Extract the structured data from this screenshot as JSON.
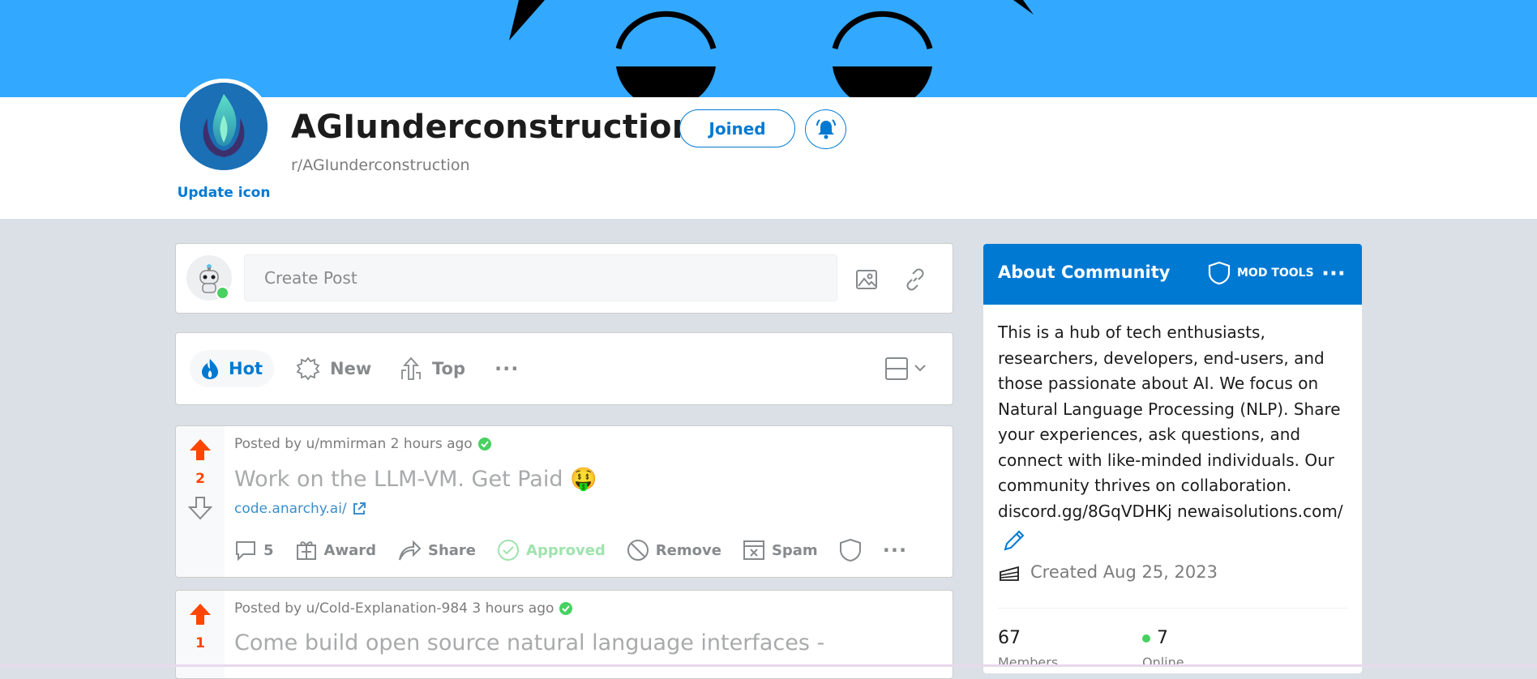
{
  "community": {
    "title": "AGIunderconstruction",
    "subreddit": "r/AGIunderconstruction",
    "update_icon_label": "Update icon",
    "joined_label": "Joined"
  },
  "create_post": {
    "placeholder": "Create Post"
  },
  "sort": {
    "hot": "Hot",
    "new": "New",
    "top": "Top"
  },
  "posts": [
    {
      "score": "2",
      "posted_by": "Posted by u/mmirman 2 hours ago",
      "title": "Work on the LLM-VM. Get Paid",
      "emoji": "🤑",
      "link": "code.anarchy.ai/",
      "comments": "5",
      "award": "Award",
      "share": "Share",
      "approved": "Approved",
      "remove": "Remove",
      "spam": "Spam"
    },
    {
      "score": "1",
      "posted_by": "Posted by u/Cold-Explanation-984 3 hours ago",
      "title": "Come build open source natural language interfaces -"
    }
  ],
  "about": {
    "title": "About Community",
    "mod_tools": "MOD TOOLS",
    "description": "This is a hub of tech enthusiasts, researchers, developers, end-users, and those passionate about AI. We focus on Natural Language Processing (NLP). Share your experiences, ask questions, and connect with like-minded individuals. Our community thrives on collaboration. discord.gg/8GqVDHKj newaisolutions.com/",
    "created": "Created Aug 25, 2023",
    "members_count": "67",
    "members_label": "Members",
    "online_count": "7",
    "online_label": "Online"
  },
  "colors": {
    "banner": "#33a8ff",
    "accent": "#0079d3",
    "upvote": "#ff4500",
    "online": "#46d160",
    "approved": "#46d160"
  }
}
